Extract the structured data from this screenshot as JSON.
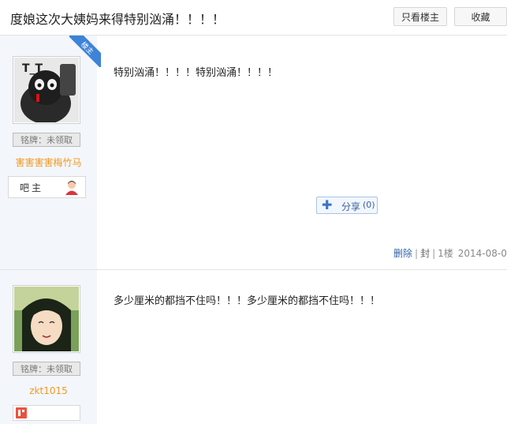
{
  "header": {
    "title": "度娘这次大姨妈来得特别汹涌！！！！",
    "only_op_label": "只看楼主",
    "favorite_label": "收藏"
  },
  "posts": [
    {
      "owner_tag": "楼主",
      "badge": "铭牌：未领取",
      "username": "害害害害梅竹马",
      "role": "吧主",
      "content": "特别汹涌！！！！特别汹涌！！！！",
      "share": {
        "label": "分享",
        "count": "(0)"
      },
      "footer": {
        "delete_label": "删除",
        "ban_label": "封",
        "floor": "1楼",
        "date": "2014-08-0"
      }
    },
    {
      "badge": "铭牌：未领取",
      "username": "zkt1015",
      "content": "多少厘米的都挡不住吗！！！多少厘米的都挡不住吗！！！"
    }
  ],
  "colors": {
    "sidebar_bg": "#f3f6fb",
    "username": "#f29a22",
    "link": "#3164a8",
    "owner_ribbon": "#3d83d7"
  }
}
